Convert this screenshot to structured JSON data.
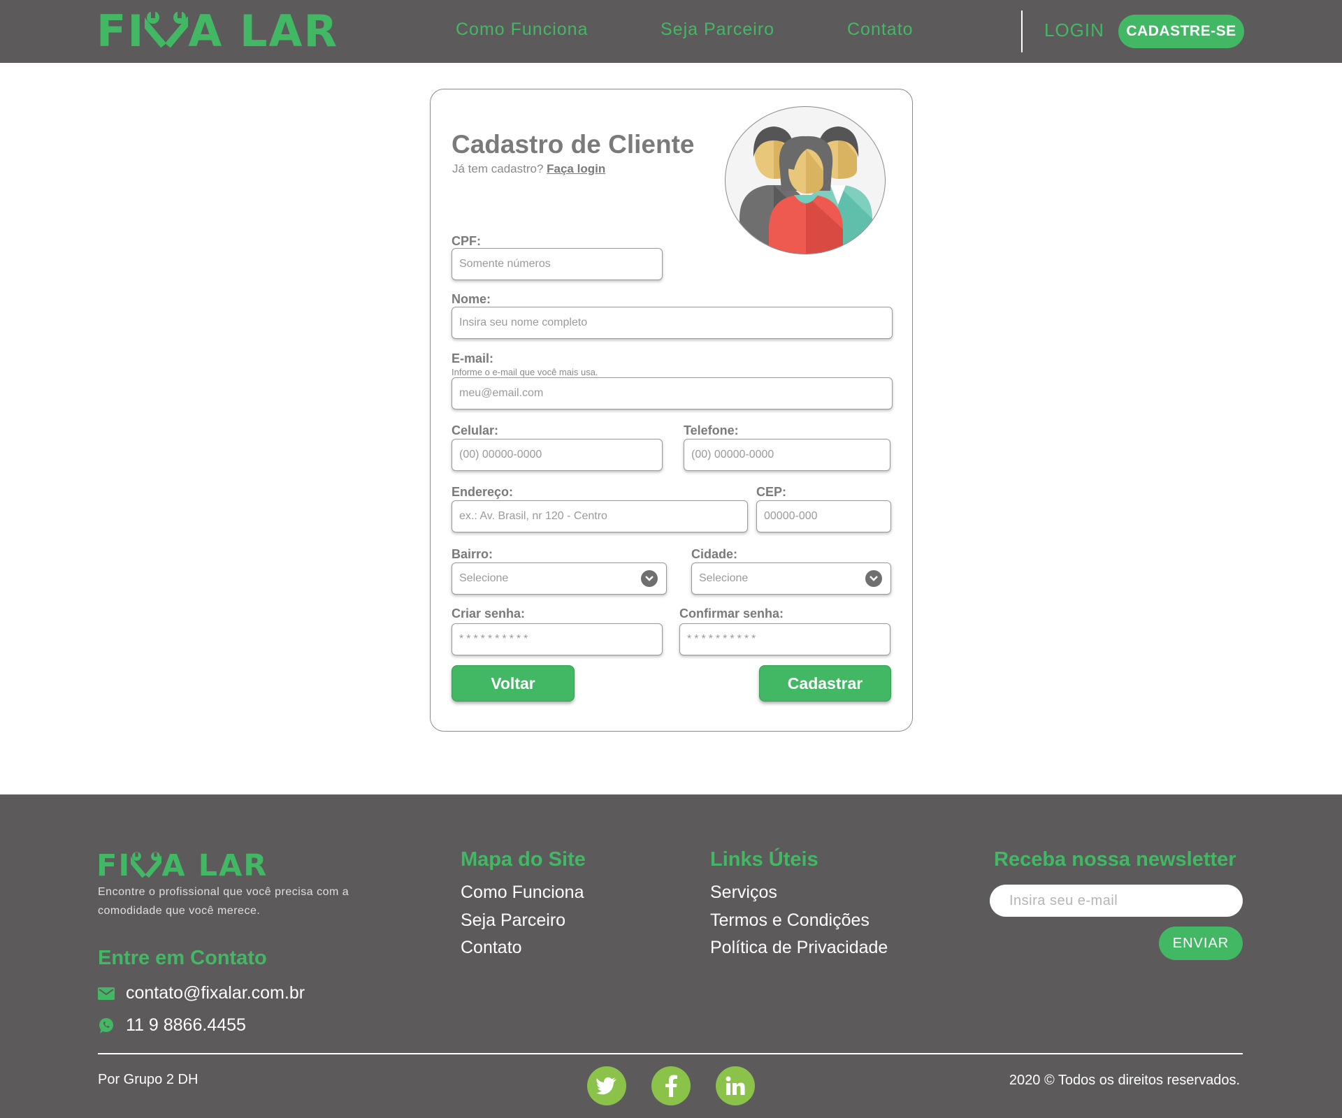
{
  "brand": {
    "name_left": "FI",
    "name_right": "A LAR",
    "accent_color": "#42b864",
    "dark_color": "#5c5a5b"
  },
  "header": {
    "nav": [
      {
        "label": "Como Funciona"
      },
      {
        "label": "Seja Parceiro"
      },
      {
        "label": "Contato"
      }
    ],
    "login_label": "LOGIN",
    "signup_label": "CADASTRE-SE"
  },
  "form": {
    "title": "Cadastro de Cliente",
    "subtitle_prefix": "Já tem cadastro?",
    "subtitle_link": "Faça login",
    "avatar_icon": "people-group-icon",
    "cpf": {
      "label": "CPF:",
      "placeholder": "Somente números"
    },
    "nome": {
      "label": "Nome:",
      "placeholder": "Insira seu nome completo"
    },
    "email": {
      "label": "E-mail:",
      "hint": "Informe o e-mail que você mais usa.",
      "placeholder": "meu@email.com"
    },
    "celular": {
      "label": "Celular:",
      "placeholder": "(00) 00000-0000"
    },
    "telefone": {
      "label": "Telefone:",
      "placeholder": "(00) 00000-0000"
    },
    "endereco": {
      "label": "Endereço:",
      "placeholder": "ex.: Av. Brasil, nr 120 - Centro"
    },
    "cep": {
      "label": "CEP:",
      "placeholder": "00000-000"
    },
    "bairro": {
      "label": "Bairro:",
      "selected": "Selecione"
    },
    "cidade": {
      "label": "Cidade:",
      "selected": "Selecione"
    },
    "senha": {
      "label": "Criar senha:",
      "placeholder": "**********"
    },
    "confirmar": {
      "label": "Confirmar senha:",
      "placeholder": "**********"
    },
    "back_label": "Voltar",
    "submit_label": "Cadastrar"
  },
  "footer": {
    "tagline": "Encontre o profissional que você precisa com a comodidade que você merece.",
    "contact_heading": "Entre em Contato",
    "email": "contato@fixalar.com.br",
    "phone": "11 9 8866.4455",
    "sitemap_heading": "Mapa do Site",
    "sitemap_links": [
      {
        "label": "Como Funciona"
      },
      {
        "label": "Seja Parceiro"
      },
      {
        "label": "Contato"
      }
    ],
    "useful_heading": "Links Úteis",
    "useful_links": [
      {
        "label": "Serviços"
      },
      {
        "label": "Termos e Condições"
      },
      {
        "label": "Política de Privacidade"
      }
    ],
    "newsletter_heading": "Receba nossa newsletter",
    "newsletter_placeholder": "Insira seu e-mail",
    "send_label": "ENVIAR",
    "credit": "Por Grupo 2 DH",
    "copyright": "2020 © Todos os direitos reservados.",
    "social": [
      {
        "icon": "twitter-icon"
      },
      {
        "icon": "facebook-icon"
      },
      {
        "icon": "linkedin-icon"
      }
    ]
  }
}
